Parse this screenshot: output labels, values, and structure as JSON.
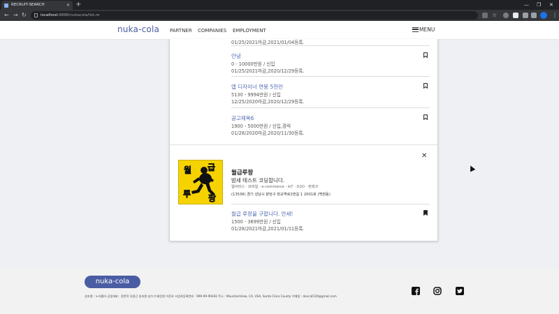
{
  "browser": {
    "tab_title": "RECRUIT-SEARCH",
    "tab_close": "✕",
    "new_tab": "+",
    "url_host": "localhost",
    "url_path": ":8888/nukacola/list.re",
    "win_min": "—",
    "win_max": "❐",
    "win_close": "✕"
  },
  "header": {
    "logo": "nuka-cola",
    "nav": [
      "PARTNER",
      "COMPANIES",
      "EMPLOYMENT"
    ],
    "menu_label": "MENU"
  },
  "postings": [
    {
      "title": "",
      "salary": "",
      "dates": "01/25/2021마감,2021/01/04등록."
    },
    {
      "title": "안녕",
      "salary": "0 - 10000만원 / 신입",
      "dates": "01/25/2021마감,2020/12/29등록."
    },
    {
      "title": "앱 디자이너 연봉 5천만",
      "salary": "5130 - 9994만원 / 신입",
      "dates": "12/25/2020마감,2020/12/29등록."
    },
    {
      "title": "공고제목6",
      "salary": "1900 - 5000만원 / 신입,경력",
      "dates": "01/28/2020마감,2020/11/30등록."
    }
  ],
  "company": {
    "logo_chars": [
      "월",
      "급",
      "루",
      "팡"
    ],
    "name": "월급루팡",
    "description": "밤새 테스트 코딩합니다.",
    "tags": "웹서비스 · 모바일 · e-commerce · IoT · O2O · 핀테크",
    "address": "(13536) 경기 성남시 분당구 판교역로2번길 1 2001호 (백현동)",
    "close": "✕",
    "posting": {
      "title": "월급 루팡을 구합니다. 만세!",
      "salary": "1500 - 3699만원 / 신입",
      "dates": "01/28/2021마감,2021/01/11등록."
    }
  },
  "footer": {
    "logo": "nuka-cola",
    "info": "상호명 : 누카콜라   공동대표 : 정찬혁 유용근 송지원 성수기 배진원 이준호   사업자등록번호 : 999-99-99292   주소 : MountainView, CA, USA, Santa Clara County   이메일 : devcat120@gmail.com"
  },
  "colors": {
    "brand": "#4a5da3",
    "link": "#4a66b0",
    "logo_bg": "#f6d300",
    "logo_text": "#e0242a"
  }
}
